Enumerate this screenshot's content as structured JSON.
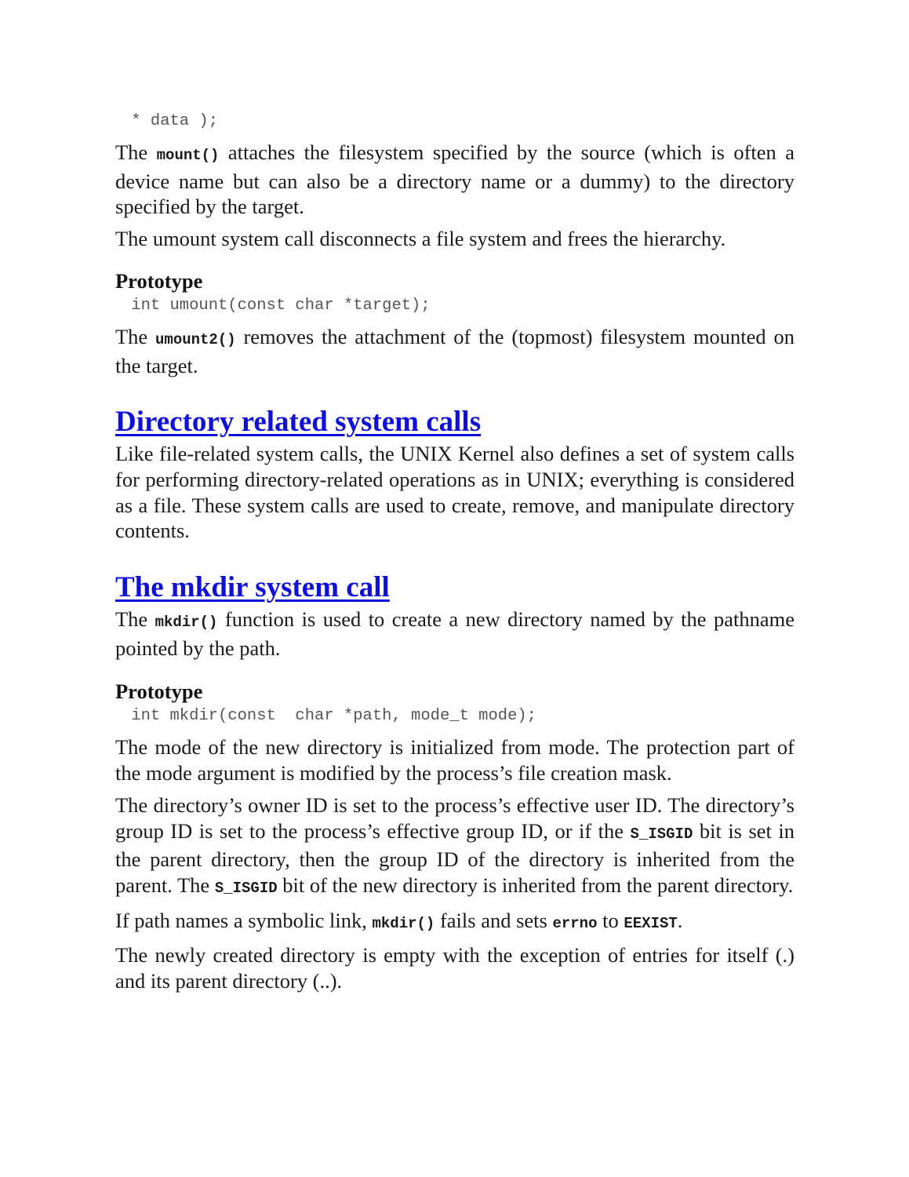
{
  "doc": {
    "code_tail": " * data );",
    "p_mount": {
      "pre": "The ",
      "code": "mount()",
      "post": " attaches the filesystem specified by the source (which is often a device name but can also be a directory name or a dummy) to the directory specified by the target."
    },
    "p_umount": "The umount system call disconnects a file system and frees the hierarchy.",
    "proto1_heading": "Prototype",
    "proto1_code": " int umount(const char *target);",
    "p_umount2": {
      "pre": "The ",
      "code": "umount2()",
      "post": " removes the attachment of the (topmost) filesystem mounted on the target."
    },
    "section1": {
      "title": "Directory related system calls",
      "body": "Like file-related system calls, the UNIX Kernel also defines a set of system calls for performing directory-related operations as in UNIX; everything is considered as a file. These system calls are used to create, remove, and manipulate directory contents."
    },
    "section2": {
      "title": "The mkdir system call",
      "intro": {
        "pre": "The ",
        "code": "mkdir()",
        "post": " function is used to create a new directory named by the pathname pointed by the path."
      },
      "proto_heading": "Prototype",
      "proto_code": " int mkdir(const  char *path, mode_t mode);",
      "p_mode": "The mode of the new directory is initialized from mode. The protection part of the mode argument is modified by the process’s file creation mask.",
      "p_owner": {
        "a": "The directory’s owner ID is set to the process’s effective user ID. The directory’s group ID is set to the process’s effective group ID, or if the ",
        "code1": "S_ISGID",
        "b": " bit is set in the parent directory, then the group ID of the directory is inherited from the parent. The ",
        "code2": "S_ISGID",
        "c": " bit of the new directory is inherited from the parent directory."
      },
      "p_symlink": {
        "a": "If path names a symbolic link, ",
        "code1": "mkdir()",
        "b": " fails and sets ",
        "code2": "errno",
        "c": " to ",
        "code3": "EEXIST",
        "d": "."
      },
      "p_empty": "The newly created directory is empty with the exception of entries for itself (.) and its parent directory (..)."
    }
  }
}
